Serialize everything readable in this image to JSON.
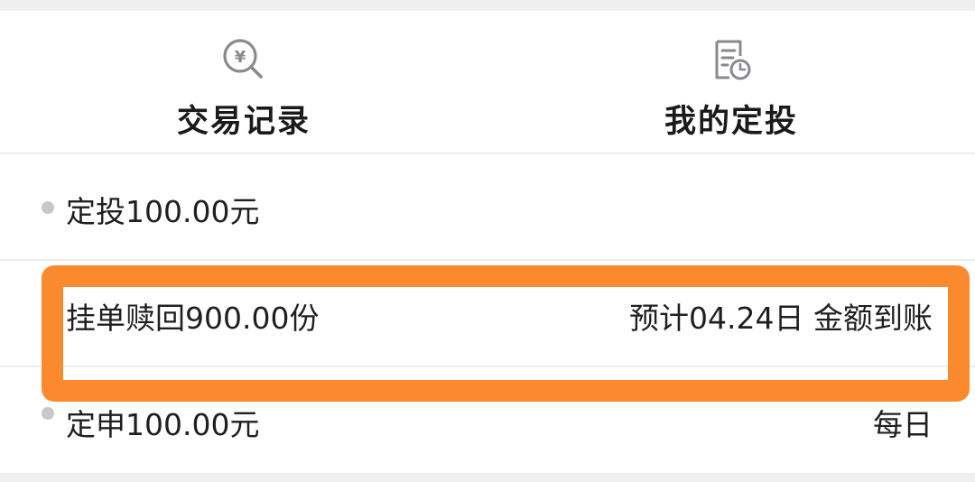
{
  "actions": [
    {
      "label": "交易记录",
      "icon": "yen-search-icon"
    },
    {
      "label": "我的定投",
      "icon": "document-clock-icon"
    }
  ],
  "rows": [
    {
      "left": "定投100.00元",
      "right": ""
    },
    {
      "left": "挂单赎回900.00份",
      "right": "预计04.24日 金额到账"
    },
    {
      "left": "定申100.00元",
      "right": "每日"
    }
  ],
  "colors": {
    "highlight": "#fb8a2e",
    "dot": "#c8c8cc",
    "text": "#1f1f1f"
  }
}
